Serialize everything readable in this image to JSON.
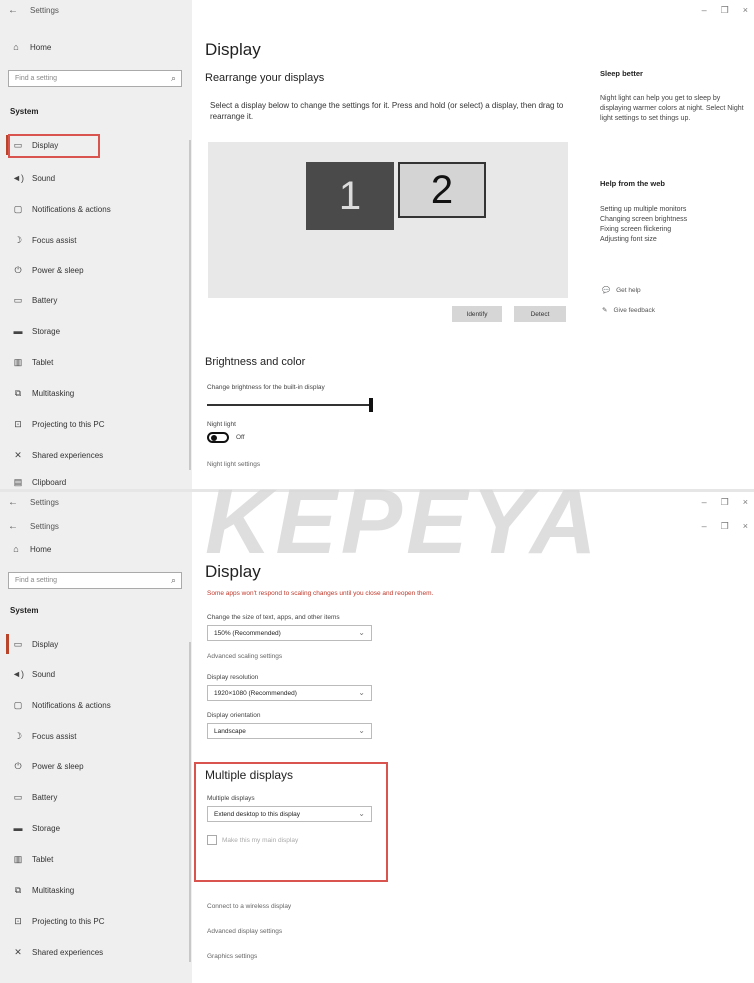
{
  "top": {
    "window_title": "Settings",
    "home_label": "Home",
    "search_placeholder": "Find a setting",
    "system_label": "System",
    "nav": [
      {
        "icon": "monitor",
        "label": "Display"
      },
      {
        "icon": "speaker",
        "label": "Sound"
      },
      {
        "icon": "message",
        "label": "Notifications & actions"
      },
      {
        "icon": "moon",
        "label": "Focus assist"
      },
      {
        "icon": "power",
        "label": "Power & sleep"
      },
      {
        "icon": "battery",
        "label": "Battery"
      },
      {
        "icon": "storage",
        "label": "Storage"
      },
      {
        "icon": "tablet",
        "label": "Tablet"
      },
      {
        "icon": "multitask",
        "label": "Multitasking"
      },
      {
        "icon": "project",
        "label": "Projecting to this PC"
      },
      {
        "icon": "shared",
        "label": "Shared experiences"
      },
      {
        "icon": "clipboard",
        "label": "Clipboard"
      }
    ],
    "page_title": "Display",
    "rearrange_title": "Rearrange your displays",
    "rearrange_desc": "Select a display below to change the settings for it. Press and hold (or select) a display, then drag to rearrange it.",
    "monitor_1": "1",
    "monitor_2": "2",
    "identify_label": "Identify",
    "detect_label": "Detect",
    "brightness_title": "Brightness and color",
    "brightness_label": "Change brightness for the built-in display",
    "brightness_value": 1.0,
    "night_light_label": "Night light",
    "night_light_state": "Off",
    "night_light_settings": "Night light settings",
    "sleep_better_title": "Sleep better",
    "sleep_better_text": "Night light can help you get to sleep by displaying warmer colors at night. Select Night light settings to set things up.",
    "help_title": "Help from the web",
    "help_links": [
      "Setting up multiple monitors",
      "Changing screen brightness",
      "Fixing screen flickering",
      "Adjusting font size"
    ],
    "get_help": "Get help",
    "give_feedback": "Give feedback"
  },
  "bottom": {
    "window_title_1": "Settings",
    "window_title_2": "Settings",
    "home_label": "Home",
    "search_placeholder": "Find a setting",
    "system_label": "System",
    "nav": [
      {
        "icon": "monitor",
        "label": "Display"
      },
      {
        "icon": "speaker",
        "label": "Sound"
      },
      {
        "icon": "message",
        "label": "Notifications & actions"
      },
      {
        "icon": "moon",
        "label": "Focus assist"
      },
      {
        "icon": "power",
        "label": "Power & sleep"
      },
      {
        "icon": "battery",
        "label": "Battery"
      },
      {
        "icon": "storage",
        "label": "Storage"
      },
      {
        "icon": "tablet",
        "label": "Tablet"
      },
      {
        "icon": "multitask",
        "label": "Multitasking"
      },
      {
        "icon": "project",
        "label": "Projecting to this PC"
      },
      {
        "icon": "shared",
        "label": "Shared experiences"
      }
    ],
    "page_title": "Display",
    "warning": "Some apps won't respond to scaling changes until you close and reopen them.",
    "scale_label": "Change the size of text, apps, and other items",
    "scale_value": "150% (Recommended)",
    "advanced_scaling": "Advanced scaling settings",
    "resolution_label": "Display resolution",
    "resolution_value": "1920×1080 (Recommended)",
    "orientation_label": "Display orientation",
    "orientation_value": "Landscape",
    "multi_title": "Multiple displays",
    "multi_label": "Multiple displays",
    "multi_value": "Extend desktop to this display",
    "main_display_label": "Make this my main display",
    "wireless_link": "Connect to a wireless display",
    "advanced_display": "Advanced display settings",
    "graphics_settings": "Graphics settings"
  },
  "watermark": "KEPEYA",
  "colors": {
    "highlight": "#d9534f",
    "sidebar": "#efefef",
    "monitor_active": "#4a4a4a",
    "warning": "#c0392b"
  }
}
